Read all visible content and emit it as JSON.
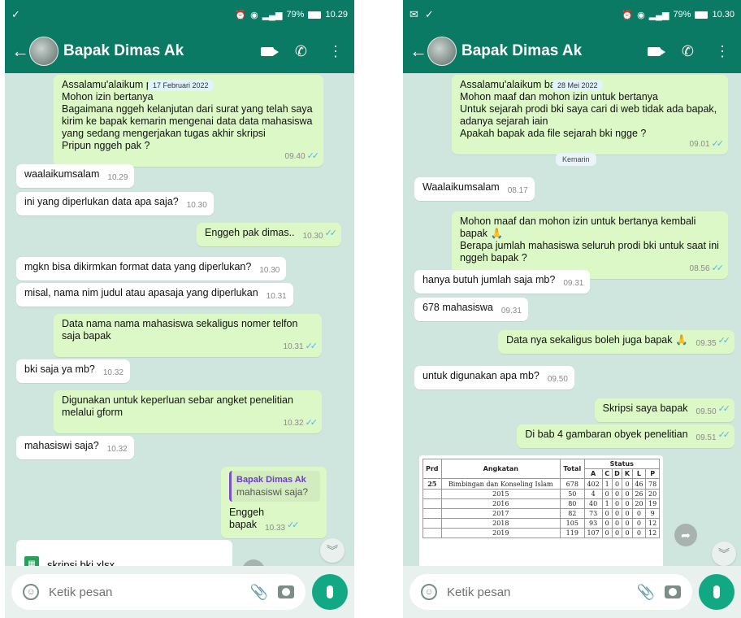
{
  "left": {
    "status": {
      "time": "10.29",
      "battery": "79%"
    },
    "contact": "Bapak Dimas Ak",
    "date_pill": "17 Februari 2022",
    "messages": [
      {
        "text": "Assalamu'alaikum pak\nMohon izin bertanya\nBagaimana nggeh kelanjutan dari surat yang telah saya kirim ke bapak kemarin mengenai data data mahasiswa yang sedang mengerjakan tugas akhir skripsi\nPripun nggeh pak ?",
        "time": "09.40"
      },
      {
        "text": "waalaikumsalam",
        "time": "10.29"
      },
      {
        "text": "ini yang diperlukan data apa saja?",
        "time": "10.30"
      },
      {
        "text": "Enggeh pak dimas..",
        "time": "10.30"
      },
      {
        "text": "mgkn bisa dikirmkan format data yang diperlukan?",
        "time": "10.30"
      },
      {
        "text": "misal, nama nim judul atau apasaja yang diperlukan",
        "time": "10.31"
      },
      {
        "text": "Data nama nama mahasiswa sekaligus nomer telfon saja bapak",
        "time": "10.31"
      },
      {
        "text": "bki saja ya mb?",
        "time": "10.32"
      },
      {
        "text": "Digunakan untuk keperluan sebar angket penelitian melalui gform",
        "time": "10.32"
      },
      {
        "text": "mahasiswi saja?",
        "time": "10.32"
      },
      {
        "quote_name": "Bapak Dimas Ak",
        "quote_text": "mahasiswi saja?",
        "text": "Enggeh bapak",
        "time": "10.33"
      }
    ],
    "file_name": "skripsi bki.xlsx",
    "input_placeholder": "Ketik pesan"
  },
  "right": {
    "status": {
      "time": "10.30",
      "battery": "79%"
    },
    "contact": "Bapak Dimas Ak",
    "date_pill": "28 Mei 2022",
    "separator": "Kemarin",
    "messages": [
      {
        "text": "Assalamu'alaikum bapak\nMohon maaf dan mohon izin untuk bertanya\nUntuk sejarah prodi bki saya cari di web tidak ada bapak, adanya sejarah iain\nApakah bapak ada file sejarah bki ngge ?",
        "time": "09.01"
      },
      {
        "text": "Waalaikumsalam",
        "time": "08.17"
      },
      {
        "text": "Mohon maaf dan mohon izin untuk bertanya kembali bapak 🙏\nBerapa jumlah mahasiswa seluruh prodi bki untuk saat ini nggeh bapak ?",
        "time": "08.56"
      },
      {
        "text": "hanya butuh jumlah saja mb?",
        "time": "09.31"
      },
      {
        "text": "678 mahasiswa",
        "time": "09.31"
      },
      {
        "text": "Data nya sekaligus boleh juga bapak 🙏",
        "time": "09.35"
      },
      {
        "text": "untuk digunakan apa mb?",
        "time": "09.50"
      },
      {
        "text": "Skripsi saya bapak",
        "time": "09.50"
      },
      {
        "text": "Di bab 4 gambaran obyek penelitian",
        "time": "09.51"
      }
    ],
    "table": {
      "headers": [
        "Prd",
        "Angkatan",
        "Total",
        "Status",
        "A",
        "C",
        "D",
        "K",
        "L",
        "P"
      ],
      "first_row": {
        "prd": "25",
        "angkatan": "Bimbingan dan Konseling Islam",
        "total": "678",
        "vals": [
          "402",
          "1",
          "0",
          "0",
          "46",
          "78"
        ]
      },
      "rows": [
        {
          "year": "2015",
          "total": "50",
          "vals": [
            "4",
            "0",
            "0",
            "0",
            "26",
            "20"
          ]
        },
        {
          "year": "2016",
          "total": "80",
          "vals": [
            "40",
            "1",
            "0",
            "0",
            "20",
            "19"
          ]
        },
        {
          "year": "2017",
          "total": "82",
          "vals": [
            "73",
            "0",
            "0",
            "0",
            "0",
            "9"
          ]
        },
        {
          "year": "2018",
          "total": "105",
          "vals": [
            "93",
            "0",
            "0",
            "0",
            "0",
            "12"
          ]
        },
        {
          "year": "2019",
          "total": "119",
          "vals": [
            "107",
            "0",
            "0",
            "0",
            "0",
            "12"
          ]
        }
      ]
    },
    "input_placeholder": "Ketik pesan"
  }
}
